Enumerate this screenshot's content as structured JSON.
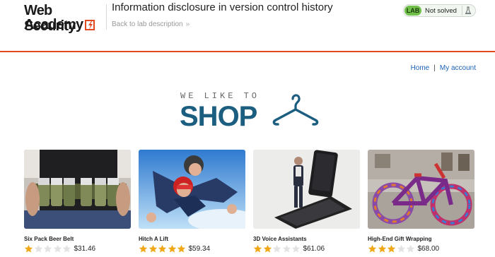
{
  "header": {
    "logo_line1": "Web Security",
    "logo_line2": "Academy",
    "lab_title": "Information disclosure in version control history",
    "back_link": "Back to lab description",
    "back_chevron": "»",
    "status_badge": "LAB",
    "status_text": "Not solved",
    "colors": {
      "accent": "#e24920",
      "lab_badge": "#70c04a"
    }
  },
  "nav": {
    "home": "Home",
    "separator": "|",
    "my_account": "My account"
  },
  "banner": {
    "tagline": "WE LIKE TO",
    "headline": "SHOP",
    "icon": "hanger-icon",
    "color": "#1c5e80"
  },
  "products": [
    {
      "name": "Six Pack Beer Belt",
      "rating": 1,
      "price": "$31.46"
    },
    {
      "name": "Hitch A Lift",
      "rating": 5,
      "price": "$59.34"
    },
    {
      "name": "3D Voice Assistants",
      "rating": 2,
      "price": "$61.06"
    },
    {
      "name": "High-End Gift Wrapping",
      "rating": 3,
      "price": "$68.00"
    }
  ]
}
